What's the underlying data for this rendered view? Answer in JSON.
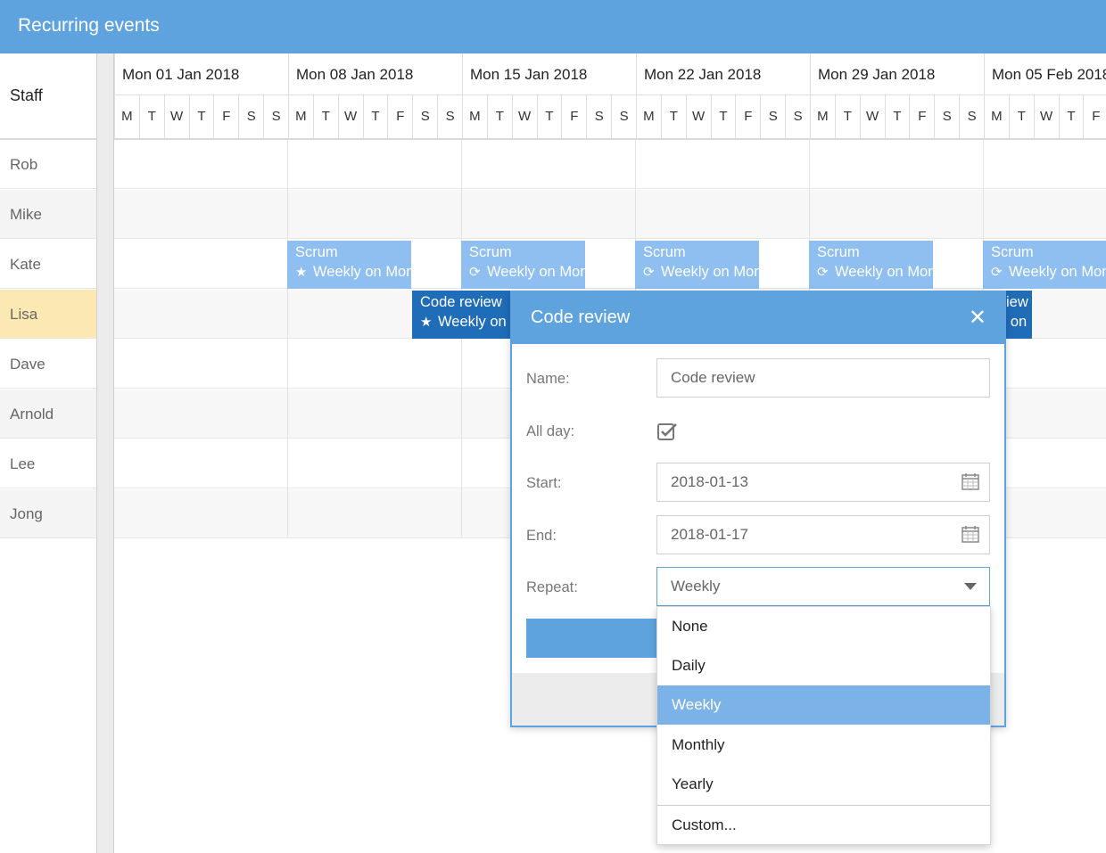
{
  "app": {
    "title": "Recurring events"
  },
  "staff": {
    "header": "Staff",
    "names": [
      "Rob",
      "Mike",
      "Kate",
      "Lisa",
      "Dave",
      "Arnold",
      "Lee",
      "Jong"
    ]
  },
  "timeline": {
    "weeks": [
      "Mon 01 Jan 2018",
      "Mon 08 Jan 2018",
      "Mon 15 Jan 2018",
      "Mon 22 Jan 2018",
      "Mon 29 Jan 2018",
      "Mon 05 Feb 2018"
    ],
    "day_letters": [
      "M",
      "T",
      "W",
      "T",
      "F",
      "S",
      "S"
    ]
  },
  "events": {
    "scrum_title": "Scrum",
    "scrum_subtitle": "Weekly on Mon",
    "code_review_title": "Code review",
    "code_review_subtitle": "Weekly on Sat",
    "partial_title": "iew",
    "partial_subtitle": "y on"
  },
  "popup": {
    "title": "Code review",
    "close_icon": "close-icon",
    "labels": {
      "name": "Name:",
      "allday": "All day:",
      "start": "Start:",
      "end": "End:",
      "repeat": "Repeat:"
    },
    "name_value": "Code review",
    "allday_checked": true,
    "start_value": "2018-01-13",
    "end_value": "2018-01-17",
    "repeat_value": "Weekly"
  },
  "repeat_options": [
    "None",
    "Daily",
    "Weekly",
    "Monthly",
    "Yearly",
    "Custom..."
  ],
  "repeat_selected": "Weekly",
  "colors": {
    "accent": "#5fa3de",
    "event_light": "#8ebff0",
    "event_dark": "#1f6cb8",
    "highlight_row": "#fbe8b2"
  }
}
